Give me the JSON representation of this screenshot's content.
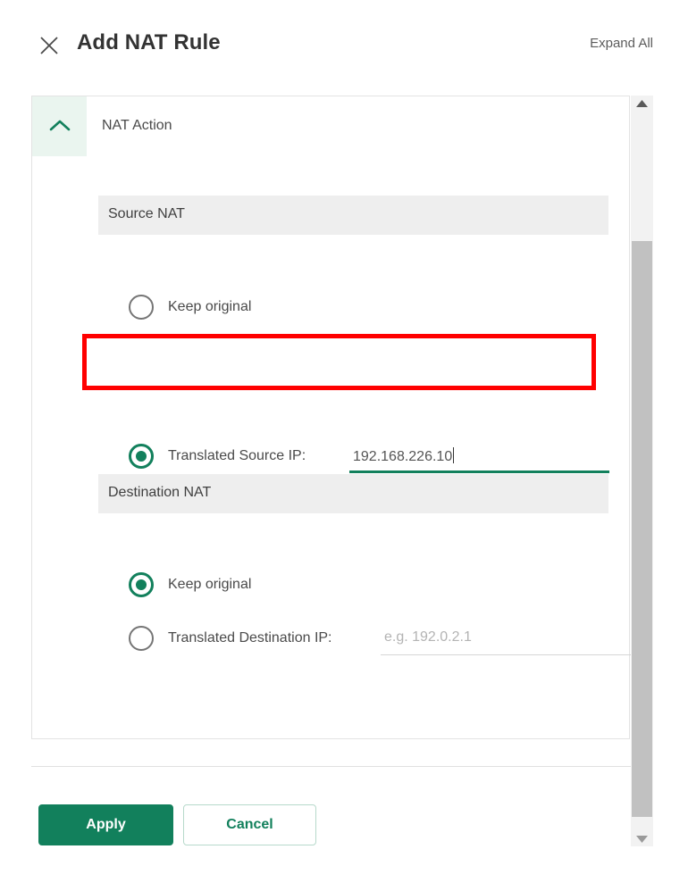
{
  "header": {
    "title": "Add NAT Rule",
    "close_icon": "close-icon",
    "expand_all_label": "Expand All"
  },
  "section": {
    "label": "NAT Action",
    "collapse_icon": "chevron-up-icon",
    "expanded": true
  },
  "source_nat": {
    "title": "Source NAT",
    "options": [
      {
        "label": "Keep original",
        "selected": false
      },
      {
        "label": "Translated Source IP:",
        "selected": true
      }
    ],
    "input": {
      "value": "192.168.226.10",
      "placeholder": "",
      "focused": true
    }
  },
  "destination_nat": {
    "title": "Destination NAT",
    "options": [
      {
        "label": "Keep original",
        "selected": true
      },
      {
        "label": "Translated Destination IP:",
        "selected": false
      }
    ],
    "input": {
      "value": "",
      "placeholder": "e.g. 192.0.2.1",
      "focused": false
    }
  },
  "footer": {
    "apply_label": "Apply",
    "cancel_label": "Cancel"
  },
  "scrollbar": {
    "up_icon": "triangle-up-icon",
    "down_icon": "triangle-down-icon"
  },
  "annotation": {
    "highlight_color": "#ff0000",
    "target": "translated-source-ip-row"
  },
  "colors": {
    "accent_green": "#12805c",
    "accent_green_tint": "#eaf5ef",
    "subsection_grey": "#eeeeee",
    "text_primary": "#3d3d3d",
    "placeholder_grey": "#b3b3b3"
  }
}
